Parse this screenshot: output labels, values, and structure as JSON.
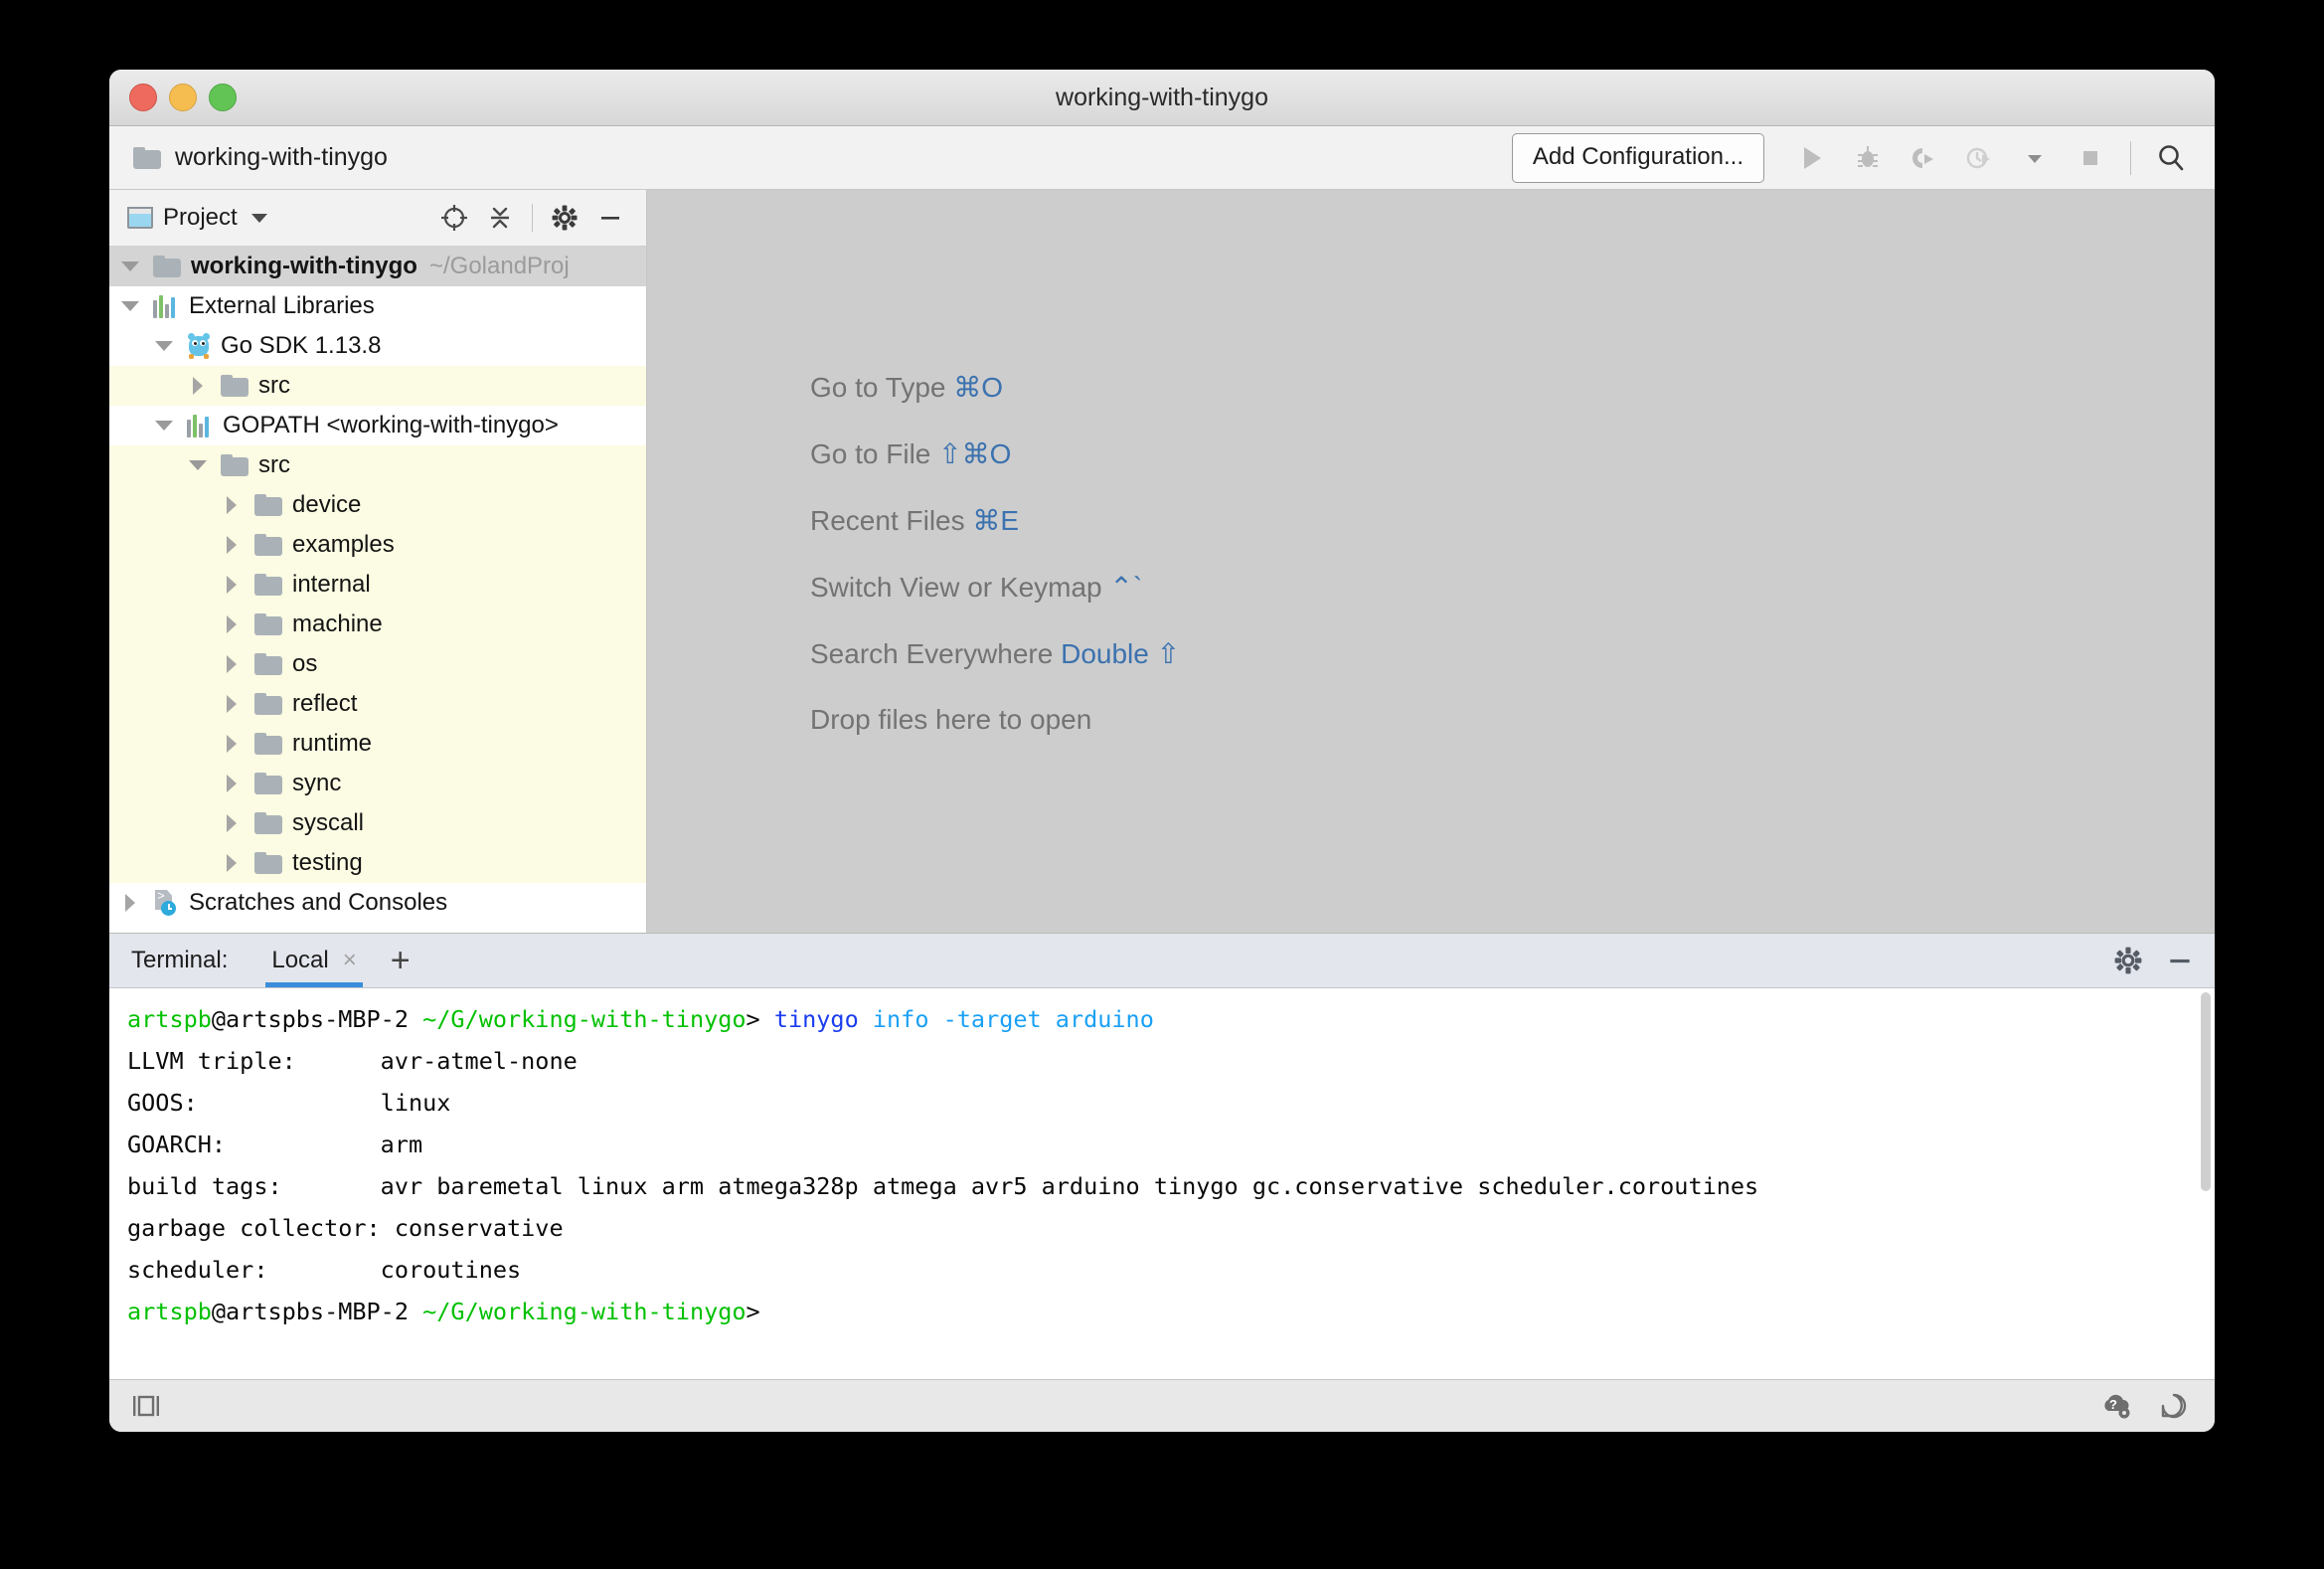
{
  "window": {
    "title": "working-with-tinygo",
    "traffic_lights": [
      "close-button",
      "minimize-button",
      "zoom-button"
    ]
  },
  "navbar": {
    "breadcrumb": "working-with-tinygo",
    "add_configuration_label": "Add Configuration...",
    "icons": [
      "run-icon",
      "debug-icon",
      "run-coverage-icon",
      "profile-icon",
      "dropdown-icon",
      "stop-icon",
      "search-icon"
    ]
  },
  "project_panel": {
    "title": "Project",
    "header_icons": [
      "select-opened-file-icon",
      "collapse-all-icon",
      "settings-icon",
      "hide-icon"
    ],
    "tree": [
      {
        "label": "working-with-tinygo",
        "path": "~/GolandProj",
        "indent": 0,
        "arrow": "down",
        "icon": "folder",
        "bold": true,
        "state": "selected"
      },
      {
        "label": "External Libraries",
        "path": "",
        "indent": 0,
        "arrow": "down",
        "icon": "libs",
        "bold": false,
        "state": "normal"
      },
      {
        "label": "Go SDK 1.13.8",
        "path": "",
        "indent": 1,
        "arrow": "down",
        "icon": "gopher",
        "bold": false,
        "state": "normal"
      },
      {
        "label": "src",
        "path": "",
        "indent": 2,
        "arrow": "right",
        "icon": "folder",
        "bold": false,
        "state": "highlight"
      },
      {
        "label": "GOPATH <working-with-tinygo>",
        "path": "",
        "indent": 1,
        "arrow": "down",
        "icon": "libs",
        "bold": false,
        "state": "normal"
      },
      {
        "label": "src",
        "path": "",
        "indent": 2,
        "arrow": "down",
        "icon": "folder",
        "bold": false,
        "state": "highlight"
      },
      {
        "label": "device",
        "path": "",
        "indent": 3,
        "arrow": "right",
        "icon": "folder",
        "bold": false,
        "state": "highlight"
      },
      {
        "label": "examples",
        "path": "",
        "indent": 3,
        "arrow": "right",
        "icon": "folder",
        "bold": false,
        "state": "highlight"
      },
      {
        "label": "internal",
        "path": "",
        "indent": 3,
        "arrow": "right",
        "icon": "folder",
        "bold": false,
        "state": "highlight"
      },
      {
        "label": "machine",
        "path": "",
        "indent": 3,
        "arrow": "right",
        "icon": "folder",
        "bold": false,
        "state": "highlight"
      },
      {
        "label": "os",
        "path": "",
        "indent": 3,
        "arrow": "right",
        "icon": "folder",
        "bold": false,
        "state": "highlight"
      },
      {
        "label": "reflect",
        "path": "",
        "indent": 3,
        "arrow": "right",
        "icon": "folder",
        "bold": false,
        "state": "highlight"
      },
      {
        "label": "runtime",
        "path": "",
        "indent": 3,
        "arrow": "right",
        "icon": "folder",
        "bold": false,
        "state": "highlight"
      },
      {
        "label": "sync",
        "path": "",
        "indent": 3,
        "arrow": "right",
        "icon": "folder",
        "bold": false,
        "state": "highlight"
      },
      {
        "label": "syscall",
        "path": "",
        "indent": 3,
        "arrow": "right",
        "icon": "folder",
        "bold": false,
        "state": "highlight"
      },
      {
        "label": "testing",
        "path": "",
        "indent": 3,
        "arrow": "right",
        "icon": "folder",
        "bold": false,
        "state": "highlight"
      },
      {
        "label": "Scratches and Consoles",
        "path": "",
        "indent": 0,
        "arrow": "right",
        "icon": "scratch",
        "bold": false,
        "state": "normal"
      }
    ]
  },
  "editor": {
    "tips": [
      {
        "action": "Go to Type ",
        "key": "⌘O"
      },
      {
        "action": "Go to File ",
        "key": "⇧⌘O"
      },
      {
        "action": "Recent Files ",
        "key": "⌘E"
      },
      {
        "action": "Switch View or Keymap ",
        "key": "⌃`"
      },
      {
        "action": "Search Everywhere ",
        "key": "Double ⇧"
      },
      {
        "action": "Drop files here to open",
        "key": ""
      }
    ]
  },
  "terminal": {
    "label": "Terminal:",
    "tab_name": "Local",
    "close_label": "×",
    "add_label": "+",
    "header_icons": [
      "settings-icon",
      "hide-icon"
    ],
    "lines": [
      {
        "segments": [
          {
            "text": "artspb",
            "color": "green"
          },
          {
            "text": "@artspbs-MBP-2 ",
            "color": "black"
          },
          {
            "text": "~/G/working-with-tinygo",
            "color": "green"
          },
          {
            "text": "> ",
            "color": "black"
          },
          {
            "text": "tinygo",
            "color": "blue"
          },
          {
            "text": " info -target arduino",
            "color": "cyan"
          }
        ]
      },
      {
        "segments": [
          {
            "text": "LLVM triple:      avr-atmel-none",
            "color": "black"
          }
        ]
      },
      {
        "segments": [
          {
            "text": "GOOS:             linux",
            "color": "black"
          }
        ]
      },
      {
        "segments": [
          {
            "text": "GOARCH:           arm",
            "color": "black"
          }
        ]
      },
      {
        "segments": [
          {
            "text": "build tags:       avr baremetal linux arm atmega328p atmega avr5 arduino tinygo gc.conservative scheduler.coroutines",
            "color": "black"
          }
        ]
      },
      {
        "segments": [
          {
            "text": "garbage collector: conservative",
            "color": "black"
          }
        ]
      },
      {
        "segments": [
          {
            "text": "scheduler:        coroutines",
            "color": "black"
          }
        ]
      },
      {
        "segments": [
          {
            "text": "artspb",
            "color": "green"
          },
          {
            "text": "@artspbs-MBP-2 ",
            "color": "black"
          },
          {
            "text": "~/G/working-with-tinygo",
            "color": "green"
          },
          {
            "text": ">",
            "color": "black"
          }
        ]
      }
    ]
  },
  "statusbar": {
    "icons": [
      "toggle-tool-window-bars-icon",
      "help-settings-icon",
      "event-log-icon"
    ]
  },
  "colors": {
    "accent_blue": "#3a8ddb",
    "tip_key_blue": "#3b72af",
    "tree_highlight": "#fcfbe3",
    "tree_selected": "#d4d4d4",
    "terminal_green": "#00c000"
  }
}
